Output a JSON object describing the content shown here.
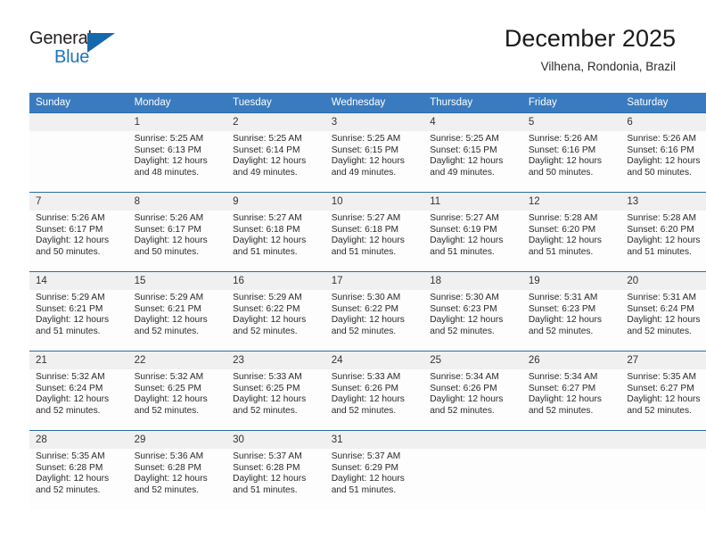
{
  "brand": {
    "name_part1": "General",
    "name_part2": "Blue",
    "logo_icon": "triangle-mark"
  },
  "header": {
    "title": "December 2025",
    "subtitle": "Vilhena, Rondonia, Brazil"
  },
  "colors": {
    "header_row_bg": "#3a7bbf",
    "cell_header_bg": "#f0f0f0",
    "row_divider": "#2e6da4",
    "brand_blue": "#1c75bc"
  },
  "weekday_headers": [
    "Sunday",
    "Monday",
    "Tuesday",
    "Wednesday",
    "Thursday",
    "Friday",
    "Saturday"
  ],
  "weeks": [
    [
      {
        "day": "",
        "sunrise": "",
        "sunset": "",
        "daylight1": "",
        "daylight2": "",
        "empty": true
      },
      {
        "day": "1",
        "sunrise": "Sunrise: 5:25 AM",
        "sunset": "Sunset: 6:13 PM",
        "daylight1": "Daylight: 12 hours",
        "daylight2": "and 48 minutes.",
        "empty": false
      },
      {
        "day": "2",
        "sunrise": "Sunrise: 5:25 AM",
        "sunset": "Sunset: 6:14 PM",
        "daylight1": "Daylight: 12 hours",
        "daylight2": "and 49 minutes.",
        "empty": false
      },
      {
        "day": "3",
        "sunrise": "Sunrise: 5:25 AM",
        "sunset": "Sunset: 6:15 PM",
        "daylight1": "Daylight: 12 hours",
        "daylight2": "and 49 minutes.",
        "empty": false
      },
      {
        "day": "4",
        "sunrise": "Sunrise: 5:25 AM",
        "sunset": "Sunset: 6:15 PM",
        "daylight1": "Daylight: 12 hours",
        "daylight2": "and 49 minutes.",
        "empty": false
      },
      {
        "day": "5",
        "sunrise": "Sunrise: 5:26 AM",
        "sunset": "Sunset: 6:16 PM",
        "daylight1": "Daylight: 12 hours",
        "daylight2": "and 50 minutes.",
        "empty": false
      },
      {
        "day": "6",
        "sunrise": "Sunrise: 5:26 AM",
        "sunset": "Sunset: 6:16 PM",
        "daylight1": "Daylight: 12 hours",
        "daylight2": "and 50 minutes.",
        "empty": false
      }
    ],
    [
      {
        "day": "7",
        "sunrise": "Sunrise: 5:26 AM",
        "sunset": "Sunset: 6:17 PM",
        "daylight1": "Daylight: 12 hours",
        "daylight2": "and 50 minutes.",
        "empty": false
      },
      {
        "day": "8",
        "sunrise": "Sunrise: 5:26 AM",
        "sunset": "Sunset: 6:17 PM",
        "daylight1": "Daylight: 12 hours",
        "daylight2": "and 50 minutes.",
        "empty": false
      },
      {
        "day": "9",
        "sunrise": "Sunrise: 5:27 AM",
        "sunset": "Sunset: 6:18 PM",
        "daylight1": "Daylight: 12 hours",
        "daylight2": "and 51 minutes.",
        "empty": false
      },
      {
        "day": "10",
        "sunrise": "Sunrise: 5:27 AM",
        "sunset": "Sunset: 6:18 PM",
        "daylight1": "Daylight: 12 hours",
        "daylight2": "and 51 minutes.",
        "empty": false
      },
      {
        "day": "11",
        "sunrise": "Sunrise: 5:27 AM",
        "sunset": "Sunset: 6:19 PM",
        "daylight1": "Daylight: 12 hours",
        "daylight2": "and 51 minutes.",
        "empty": false
      },
      {
        "day": "12",
        "sunrise": "Sunrise: 5:28 AM",
        "sunset": "Sunset: 6:20 PM",
        "daylight1": "Daylight: 12 hours",
        "daylight2": "and 51 minutes.",
        "empty": false
      },
      {
        "day": "13",
        "sunrise": "Sunrise: 5:28 AM",
        "sunset": "Sunset: 6:20 PM",
        "daylight1": "Daylight: 12 hours",
        "daylight2": "and 51 minutes.",
        "empty": false
      }
    ],
    [
      {
        "day": "14",
        "sunrise": "Sunrise: 5:29 AM",
        "sunset": "Sunset: 6:21 PM",
        "daylight1": "Daylight: 12 hours",
        "daylight2": "and 51 minutes.",
        "empty": false
      },
      {
        "day": "15",
        "sunrise": "Sunrise: 5:29 AM",
        "sunset": "Sunset: 6:21 PM",
        "daylight1": "Daylight: 12 hours",
        "daylight2": "and 52 minutes.",
        "empty": false
      },
      {
        "day": "16",
        "sunrise": "Sunrise: 5:29 AM",
        "sunset": "Sunset: 6:22 PM",
        "daylight1": "Daylight: 12 hours",
        "daylight2": "and 52 minutes.",
        "empty": false
      },
      {
        "day": "17",
        "sunrise": "Sunrise: 5:30 AM",
        "sunset": "Sunset: 6:22 PM",
        "daylight1": "Daylight: 12 hours",
        "daylight2": "and 52 minutes.",
        "empty": false
      },
      {
        "day": "18",
        "sunrise": "Sunrise: 5:30 AM",
        "sunset": "Sunset: 6:23 PM",
        "daylight1": "Daylight: 12 hours",
        "daylight2": "and 52 minutes.",
        "empty": false
      },
      {
        "day": "19",
        "sunrise": "Sunrise: 5:31 AM",
        "sunset": "Sunset: 6:23 PM",
        "daylight1": "Daylight: 12 hours",
        "daylight2": "and 52 minutes.",
        "empty": false
      },
      {
        "day": "20",
        "sunrise": "Sunrise: 5:31 AM",
        "sunset": "Sunset: 6:24 PM",
        "daylight1": "Daylight: 12 hours",
        "daylight2": "and 52 minutes.",
        "empty": false
      }
    ],
    [
      {
        "day": "21",
        "sunrise": "Sunrise: 5:32 AM",
        "sunset": "Sunset: 6:24 PM",
        "daylight1": "Daylight: 12 hours",
        "daylight2": "and 52 minutes.",
        "empty": false
      },
      {
        "day": "22",
        "sunrise": "Sunrise: 5:32 AM",
        "sunset": "Sunset: 6:25 PM",
        "daylight1": "Daylight: 12 hours",
        "daylight2": "and 52 minutes.",
        "empty": false
      },
      {
        "day": "23",
        "sunrise": "Sunrise: 5:33 AM",
        "sunset": "Sunset: 6:25 PM",
        "daylight1": "Daylight: 12 hours",
        "daylight2": "and 52 minutes.",
        "empty": false
      },
      {
        "day": "24",
        "sunrise": "Sunrise: 5:33 AM",
        "sunset": "Sunset: 6:26 PM",
        "daylight1": "Daylight: 12 hours",
        "daylight2": "and 52 minutes.",
        "empty": false
      },
      {
        "day": "25",
        "sunrise": "Sunrise: 5:34 AM",
        "sunset": "Sunset: 6:26 PM",
        "daylight1": "Daylight: 12 hours",
        "daylight2": "and 52 minutes.",
        "empty": false
      },
      {
        "day": "26",
        "sunrise": "Sunrise: 5:34 AM",
        "sunset": "Sunset: 6:27 PM",
        "daylight1": "Daylight: 12 hours",
        "daylight2": "and 52 minutes.",
        "empty": false
      },
      {
        "day": "27",
        "sunrise": "Sunrise: 5:35 AM",
        "sunset": "Sunset: 6:27 PM",
        "daylight1": "Daylight: 12 hours",
        "daylight2": "and 52 minutes.",
        "empty": false
      }
    ],
    [
      {
        "day": "28",
        "sunrise": "Sunrise: 5:35 AM",
        "sunset": "Sunset: 6:28 PM",
        "daylight1": "Daylight: 12 hours",
        "daylight2": "and 52 minutes.",
        "empty": false
      },
      {
        "day": "29",
        "sunrise": "Sunrise: 5:36 AM",
        "sunset": "Sunset: 6:28 PM",
        "daylight1": "Daylight: 12 hours",
        "daylight2": "and 52 minutes.",
        "empty": false
      },
      {
        "day": "30",
        "sunrise": "Sunrise: 5:37 AM",
        "sunset": "Sunset: 6:28 PM",
        "daylight1": "Daylight: 12 hours",
        "daylight2": "and 51 minutes.",
        "empty": false
      },
      {
        "day": "31",
        "sunrise": "Sunrise: 5:37 AM",
        "sunset": "Sunset: 6:29 PM",
        "daylight1": "Daylight: 12 hours",
        "daylight2": "and 51 minutes.",
        "empty": false
      },
      {
        "day": "",
        "sunrise": "",
        "sunset": "",
        "daylight1": "",
        "daylight2": "",
        "empty": true
      },
      {
        "day": "",
        "sunrise": "",
        "sunset": "",
        "daylight1": "",
        "daylight2": "",
        "empty": true
      },
      {
        "day": "",
        "sunrise": "",
        "sunset": "",
        "daylight1": "",
        "daylight2": "",
        "empty": true
      }
    ]
  ]
}
